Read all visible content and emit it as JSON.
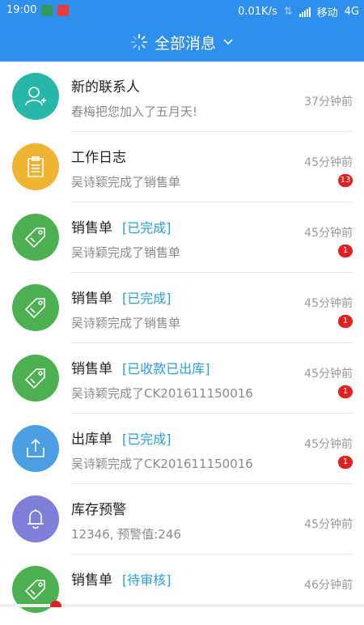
{
  "status_bar": {
    "time": "19:00",
    "speed": "0.01K/s",
    "carrier": "移动",
    "network": "4G"
  },
  "header": {
    "title": "全部消息"
  },
  "items": [
    {
      "title": "新的联系人",
      "tag": "",
      "subtitle": "春梅把您加入了五月天!",
      "time": "37分钟前",
      "badge": "",
      "icon": "add-contact-icon",
      "color": "#27b7a7"
    },
    {
      "title": "工作日志",
      "tag": "",
      "subtitle": "吴诗颖完成了销售单",
      "time": "45分钟前",
      "badge": "13",
      "icon": "clipboard-icon",
      "color": "#f0b433"
    },
    {
      "title": "销售单",
      "tag": "[已完成]",
      "subtitle": "吴诗颖完成了销售单",
      "time": "45分钟前",
      "badge": "1",
      "icon": "price-tag-icon",
      "color": "#4caf50"
    },
    {
      "title": "销售单",
      "tag": "[已完成]",
      "subtitle": "吴诗颖完成了销售单",
      "time": "45分钟前",
      "badge": "1",
      "icon": "price-tag-icon",
      "color": "#4caf50"
    },
    {
      "title": "销售单",
      "tag": "[已收款已出库]",
      "subtitle": "吴诗颖完成了CK201611150016",
      "time": "45分钟前",
      "badge": "1",
      "icon": "price-tag-icon",
      "color": "#4caf50"
    },
    {
      "title": "出库单",
      "tag": "[已完成]",
      "subtitle": "吴诗颖完成了CK201611150016",
      "time": "45分钟前",
      "badge": "1",
      "icon": "upload-box-icon",
      "color": "#4a9fe3"
    },
    {
      "title": "库存预警",
      "tag": "",
      "subtitle": "12346, 预警值:246",
      "time": "45分钟前",
      "badge": "",
      "icon": "bell-icon",
      "color": "#7e7fdb"
    },
    {
      "title": "销售单",
      "tag": "[待审核]",
      "subtitle": "",
      "time": "46分钟前",
      "badge": "",
      "icon": "price-tag-icon",
      "color": "#4caf50"
    }
  ]
}
